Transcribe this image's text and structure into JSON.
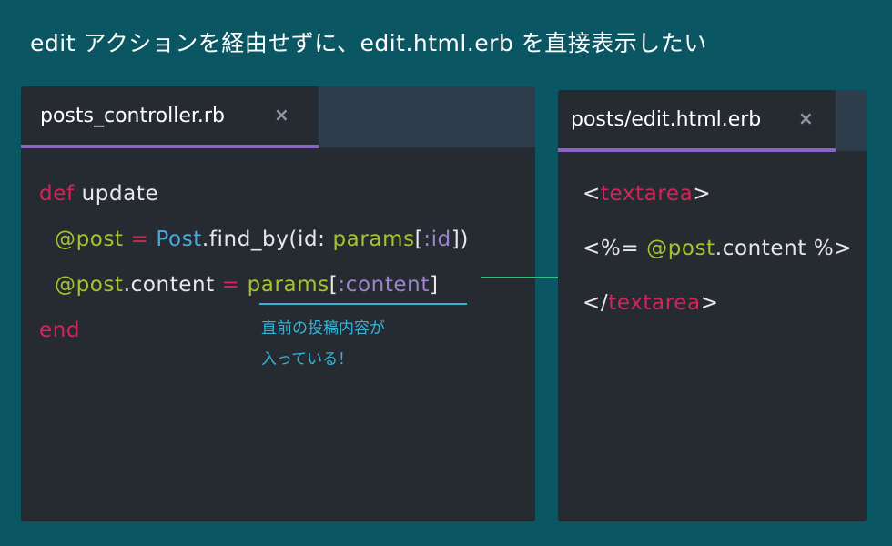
{
  "title": "edit アクションを経由せずに、edit.html.erb を直接表示したい",
  "left_panel": {
    "tab_label": "posts_controller.rb",
    "close_glyph": "×",
    "lines": {
      "l1": {
        "kw": "def",
        "rest": " update"
      },
      "l2": {
        "ivar": "@post",
        "eq": " = ",
        "cls": "Post",
        "mid": ".find_by(id: ",
        "params": "params",
        "br_open": "[",
        "sym": ":id",
        "close": "])"
      },
      "l3": {
        "ivar": "@post",
        "mid": ".content",
        "eq": " = ",
        "params": "params",
        "br_open": "[",
        "sym": ":content",
        "close": "]"
      },
      "l4": {
        "kw": "end"
      }
    },
    "note_line1": "直前の投稿内容が",
    "note_line2": "入っている！"
  },
  "right_panel": {
    "tab_label": "posts/edit.html.erb",
    "close_glyph": "×",
    "lines": {
      "l1": {
        "lt": "<",
        "tag": "textarea",
        "gt": ">"
      },
      "l2": {
        "open": "<%= ",
        "ivar": "@post",
        "rest": ".content %>"
      },
      "l3": {
        "lt": "</",
        "tag": "textarea",
        "gt": ">"
      }
    }
  },
  "colors": {
    "background": "#0b5663",
    "keyword": "#d5245a",
    "ivar": "#a6c234",
    "class": "#4aa8df",
    "symbol": "#9d84cf",
    "note": "#36b3d8",
    "arrow": "#2fc27a",
    "tab_accent": "#8a63c4"
  },
  "icons": [
    "close-icon",
    "arrow-right-icon"
  ]
}
